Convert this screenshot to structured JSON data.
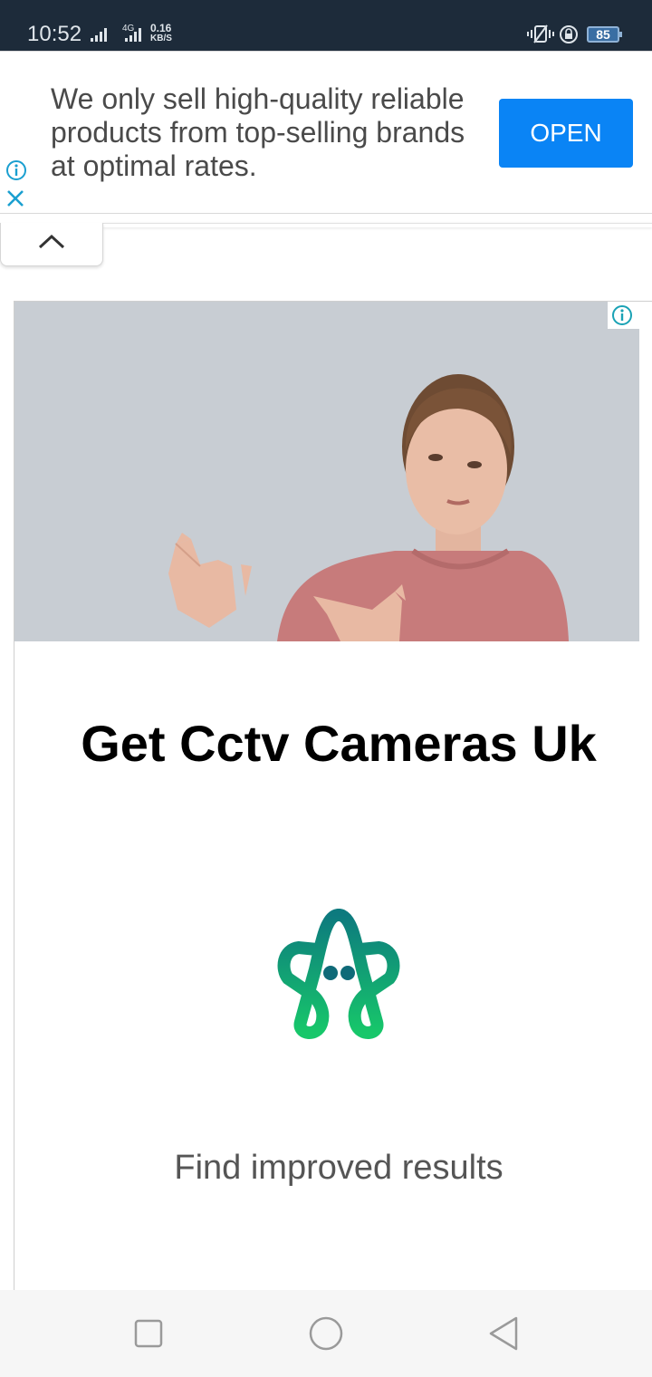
{
  "status_bar": {
    "time": "10:52",
    "network_type": "4G",
    "speed_value": "0.16",
    "speed_unit": "KB/S",
    "battery": "85",
    "icons": [
      "signal-icon",
      "signal-4g-icon",
      "vibrate-icon",
      "rotation-lock-icon",
      "battery-icon"
    ]
  },
  "top_ad": {
    "text": "We only sell high-quality reliable products from top-selling brands at optimal rates.",
    "button_label": "OPEN",
    "icons": [
      "ad-info-icon",
      "ad-close-icon"
    ],
    "accent_color": "#0a84f5"
  },
  "collapse": {
    "icon": "chevron-up-icon"
  },
  "ad": {
    "headline": "Get Cctv Cameras Uk",
    "subtext": "Find improved results",
    "icons": [
      "ad-badge-icon",
      "brand-logo"
    ],
    "logo_colors": [
      "#0f7a7a",
      "#16c46b"
    ]
  },
  "nav_bar": {
    "icons": [
      "recent-apps-icon",
      "home-icon",
      "back-icon"
    ]
  }
}
